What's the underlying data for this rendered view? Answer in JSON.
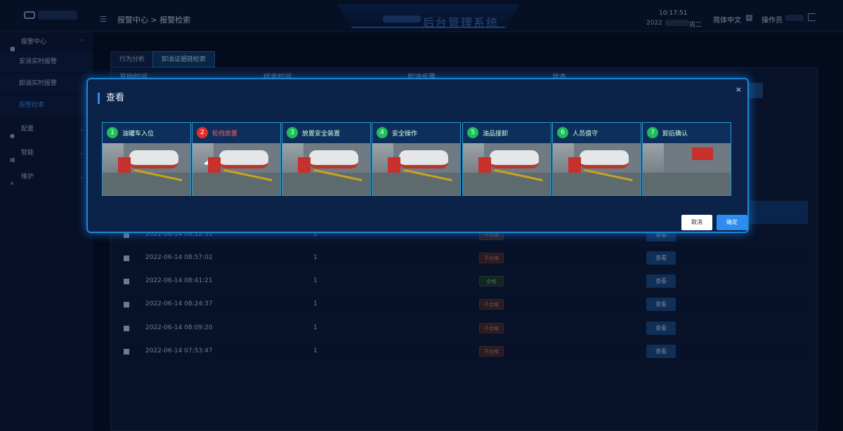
{
  "header": {
    "breadcrumb": "报警中心 > 报警检索",
    "system_title": "后台管理系统",
    "time": "10:17:51",
    "date_prefix": "2022",
    "weekday": "周二",
    "language": "简体中文",
    "user_label": "操作员"
  },
  "sidebar": {
    "groups": [
      {
        "label": "报警中心",
        "icon": "video-icon"
      },
      {
        "label": "配置",
        "icon": "settings-icon"
      },
      {
        "label": "智能",
        "icon": "grid-icon"
      },
      {
        "label": "维护",
        "icon": "tools-icon"
      }
    ],
    "sub_items": [
      "安消实时报警",
      "卸油实时报警",
      "报警检索"
    ]
  },
  "tabs": [
    "行为分析",
    "卸油证据链检索"
  ],
  "table": {
    "headers": [
      "开始时间",
      "结束时间",
      "卸油步骤",
      "状态"
    ],
    "rows": [
      {
        "time": "2022-06-14 09:12:31",
        "steps": "1",
        "status": "不合格",
        "status_type": "fail",
        "action": "查看"
      },
      {
        "time": "2022-06-14 08:57:02",
        "steps": "1",
        "status": "不合格",
        "status_type": "fail",
        "action": "查看"
      },
      {
        "time": "2022-06-14 08:41:21",
        "steps": "1",
        "status": "合格",
        "status_type": "pass",
        "action": "查看"
      },
      {
        "time": "2022-06-14 08:24:37",
        "steps": "1",
        "status": "不合格",
        "status_type": "fail",
        "action": "查看"
      },
      {
        "time": "2022-06-14 08:09:20",
        "steps": "1",
        "status": "不合格",
        "status_type": "fail",
        "action": "查看"
      },
      {
        "time": "2022-06-14 07:53:47",
        "steps": "1",
        "status": "不合格",
        "status_type": "fail",
        "action": "查看"
      }
    ]
  },
  "modal": {
    "title": "查看",
    "close": "×",
    "steps": [
      {
        "num": "1",
        "label": "油罐车入位",
        "status": "ok"
      },
      {
        "num": "2",
        "label": "轮挡放置",
        "status": "error"
      },
      {
        "num": "3",
        "label": "放置安全装置",
        "status": "ok"
      },
      {
        "num": "4",
        "label": "安全操作",
        "status": "ok"
      },
      {
        "num": "5",
        "label": "油品接卸",
        "status": "ok"
      },
      {
        "num": "6",
        "label": "人员值守",
        "status": "ok"
      },
      {
        "num": "7",
        "label": "卸后确认",
        "status": "ok"
      }
    ],
    "cancel_label": "取消",
    "ok_label": "确定"
  },
  "colors": {
    "accent": "#2d8cf0",
    "ok": "#1ebe5a",
    "error": "#e03131",
    "background": "#050d22"
  }
}
